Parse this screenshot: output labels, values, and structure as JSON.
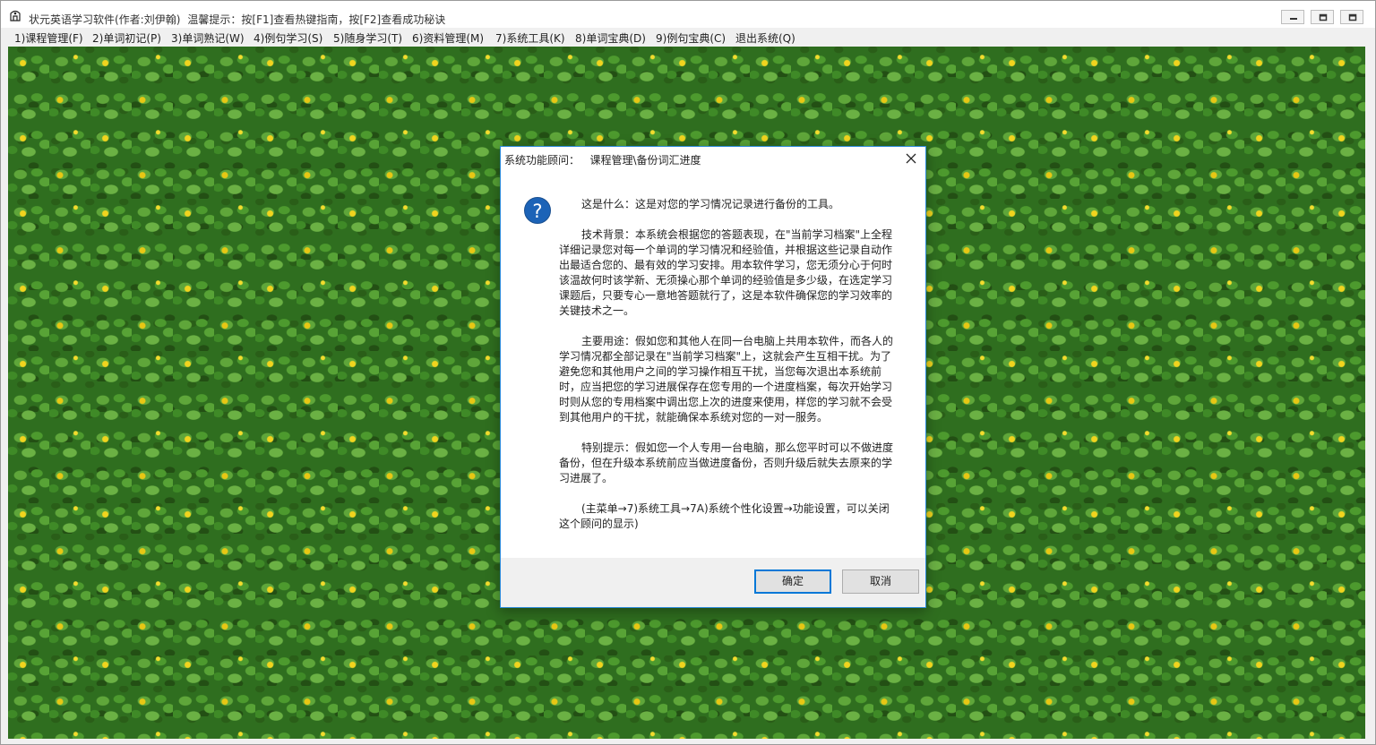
{
  "window": {
    "title": "状元英语学习软件(作者:刘伊翰)",
    "hint": "温馨提示：按[F1]查看热键指南，按[F2]查看成功秘诀"
  },
  "menu": [
    "1)课程管理(F)",
    "2)单词初记(P)",
    "3)单词熟记(W)",
    "4)例句学习(S)",
    "5)随身学习(T)",
    "6)资料管理(M)",
    "7)系统工具(K)",
    "8)单词宝典(D)",
    "9)例句宝典(C)",
    "退出系统(Q)"
  ],
  "dialog": {
    "title_prefix": "系统功能顾问：",
    "title_path": "课程管理\\备份词汇进度",
    "icon": "question-icon",
    "paragraphs": [
      "这是什么：这是对您的学习情况记录进行备份的工具。",
      "技术背景：本系统会根据您的答题表现，在\"当前学习档案\"上全程详细记录您对每一个单词的学习情况和经验值，并根据这些记录自动作出最适合您的、最有效的学习安排。用本软件学习，您无须分心于何时该温故何时该学新、无须操心那个单词的经验值是多少级，在选定学习课题后，只要专心一意地答题就行了，这是本软件确保您的学习效率的关键技术之一。",
      "主要用途：假如您和其他人在同一台电脑上共用本软件，而各人的学习情况都全部记录在\"当前学习档案\"上，这就会产生互相干扰。为了避免您和其他用户之间的学习操作相互干扰，当您每次退出本系统前时，应当把您的学习进展保存在您专用的一个进度档案，每次开始学习时则从您的专用档案中调出您上次的进度来使用，样您的学习就不会受到其他用户的干扰，就能确保本系统对您的一对一服务。",
      "特别提示：假如您一个人专用一台电脑，那么您平时可以不做进度备份，但在升级本系统前应当做进度备份，否则升级后就失去原来的学习进展了。",
      "(主菜单→7)系统工具→7A)系统个性化设置→功能设置，可以关闭这个顾问的显示)"
    ],
    "ok_label": "确定",
    "cancel_label": "取消"
  },
  "colors": {
    "dialog_border": "#2b8ad9",
    "default_button_border": "#0078d7",
    "question_icon": "#1c63b7"
  }
}
